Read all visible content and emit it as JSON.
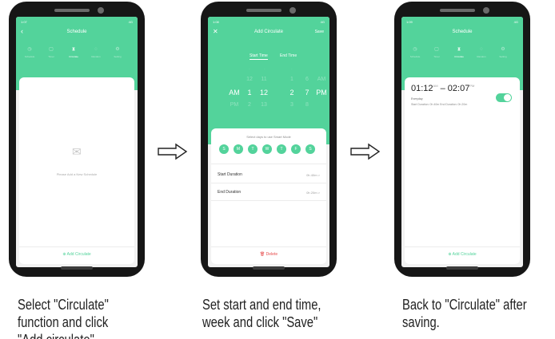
{
  "phones": [
    {
      "status_time": "1:07",
      "status_right": "4G",
      "title": "Schedule",
      "tabs": [
        "Schedule",
        "Timer",
        "Circulate",
        "Random",
        "Setting"
      ],
      "active_tab": 2,
      "empty_text": "Please Add a New Schedule",
      "add_label": "Add Circulate"
    },
    {
      "status_time": "1:08",
      "status_right": "4G",
      "title": "Add Circulate",
      "save_label": "Save",
      "picker_labels": [
        "Start Time",
        "End Time"
      ],
      "picker_rows": [
        [
          "",
          "12",
          "11",
          "",
          "1",
          "6",
          "AM"
        ],
        [
          "AM",
          "1",
          "12",
          "",
          "2",
          "7",
          "PM"
        ],
        [
          "PM",
          "2",
          "13",
          "",
          "3",
          "8",
          ""
        ]
      ],
      "days_hint": "Select days to use Smart Mode",
      "days": [
        "S",
        "M",
        "T",
        "W",
        "T",
        "F",
        "S"
      ],
      "start_duration_label": "Start Duration",
      "start_duration_value": "0h 40m >",
      "end_duration_label": "End Duration",
      "end_duration_value": "0h 20m >",
      "delete_label": "Delete"
    },
    {
      "status_time": "1:09",
      "status_right": "4G",
      "title": "Schedule",
      "tabs": [
        "Schedule",
        "Timer",
        "Circulate",
        "Random",
        "Setting"
      ],
      "active_tab": 2,
      "start_time": "01:12",
      "start_ampm": "AM",
      "dash": "–",
      "end_time": "02:07",
      "end_ampm": "PM",
      "repeat": "Everyday",
      "durations": "Start Duration: 0h 40m   End Duration: 0h 20m",
      "toggle_on": true,
      "add_label": "Add Circulate"
    }
  ],
  "captions": [
    [
      "Select  \"Circulate\"",
      "function and click",
      "\"Add circulate\""
    ],
    [
      "Set start and end time,",
      "week and click \"Save\""
    ],
    [
      "Back to \"Circulate\" after",
      "saving."
    ]
  ],
  "colors": {
    "accent": "#53d39b",
    "phone_body": "#161616",
    "danger": "#e64b4b"
  },
  "icons": {
    "tabs": [
      "clock-icon",
      "timer-icon",
      "hourglass-icon",
      "shuffle-icon",
      "gear-icon"
    ],
    "empty": "empty-box-icon",
    "add": "plus-circle-icon",
    "delete": "trash-icon"
  }
}
